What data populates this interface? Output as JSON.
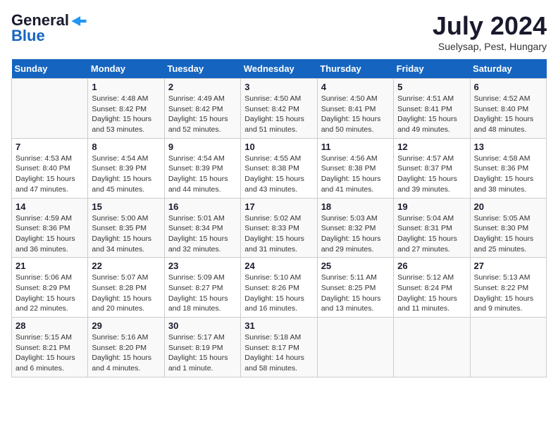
{
  "header": {
    "logo_general": "General",
    "logo_blue": "Blue",
    "month_title": "July 2024",
    "location": "Suelysap, Pest, Hungary"
  },
  "days_of_week": [
    "Sunday",
    "Monday",
    "Tuesday",
    "Wednesday",
    "Thursday",
    "Friday",
    "Saturday"
  ],
  "weeks": [
    [
      {
        "day": "",
        "info": ""
      },
      {
        "day": "1",
        "info": "Sunrise: 4:48 AM\nSunset: 8:42 PM\nDaylight: 15 hours and 53 minutes."
      },
      {
        "day": "2",
        "info": "Sunrise: 4:49 AM\nSunset: 8:42 PM\nDaylight: 15 hours and 52 minutes."
      },
      {
        "day": "3",
        "info": "Sunrise: 4:50 AM\nSunset: 8:42 PM\nDaylight: 15 hours and 51 minutes."
      },
      {
        "day": "4",
        "info": "Sunrise: 4:50 AM\nSunset: 8:41 PM\nDaylight: 15 hours and 50 minutes."
      },
      {
        "day": "5",
        "info": "Sunrise: 4:51 AM\nSunset: 8:41 PM\nDaylight: 15 hours and 49 minutes."
      },
      {
        "day": "6",
        "info": "Sunrise: 4:52 AM\nSunset: 8:40 PM\nDaylight: 15 hours and 48 minutes."
      }
    ],
    [
      {
        "day": "7",
        "info": "Sunrise: 4:53 AM\nSunset: 8:40 PM\nDaylight: 15 hours and 47 minutes."
      },
      {
        "day": "8",
        "info": "Sunrise: 4:54 AM\nSunset: 8:39 PM\nDaylight: 15 hours and 45 minutes."
      },
      {
        "day": "9",
        "info": "Sunrise: 4:54 AM\nSunset: 8:39 PM\nDaylight: 15 hours and 44 minutes."
      },
      {
        "day": "10",
        "info": "Sunrise: 4:55 AM\nSunset: 8:38 PM\nDaylight: 15 hours and 43 minutes."
      },
      {
        "day": "11",
        "info": "Sunrise: 4:56 AM\nSunset: 8:38 PM\nDaylight: 15 hours and 41 minutes."
      },
      {
        "day": "12",
        "info": "Sunrise: 4:57 AM\nSunset: 8:37 PM\nDaylight: 15 hours and 39 minutes."
      },
      {
        "day": "13",
        "info": "Sunrise: 4:58 AM\nSunset: 8:36 PM\nDaylight: 15 hours and 38 minutes."
      }
    ],
    [
      {
        "day": "14",
        "info": "Sunrise: 4:59 AM\nSunset: 8:36 PM\nDaylight: 15 hours and 36 minutes."
      },
      {
        "day": "15",
        "info": "Sunrise: 5:00 AM\nSunset: 8:35 PM\nDaylight: 15 hours and 34 minutes."
      },
      {
        "day": "16",
        "info": "Sunrise: 5:01 AM\nSunset: 8:34 PM\nDaylight: 15 hours and 32 minutes."
      },
      {
        "day": "17",
        "info": "Sunrise: 5:02 AM\nSunset: 8:33 PM\nDaylight: 15 hours and 31 minutes."
      },
      {
        "day": "18",
        "info": "Sunrise: 5:03 AM\nSunset: 8:32 PM\nDaylight: 15 hours and 29 minutes."
      },
      {
        "day": "19",
        "info": "Sunrise: 5:04 AM\nSunset: 8:31 PM\nDaylight: 15 hours and 27 minutes."
      },
      {
        "day": "20",
        "info": "Sunrise: 5:05 AM\nSunset: 8:30 PM\nDaylight: 15 hours and 25 minutes."
      }
    ],
    [
      {
        "day": "21",
        "info": "Sunrise: 5:06 AM\nSunset: 8:29 PM\nDaylight: 15 hours and 22 minutes."
      },
      {
        "day": "22",
        "info": "Sunrise: 5:07 AM\nSunset: 8:28 PM\nDaylight: 15 hours and 20 minutes."
      },
      {
        "day": "23",
        "info": "Sunrise: 5:09 AM\nSunset: 8:27 PM\nDaylight: 15 hours and 18 minutes."
      },
      {
        "day": "24",
        "info": "Sunrise: 5:10 AM\nSunset: 8:26 PM\nDaylight: 15 hours and 16 minutes."
      },
      {
        "day": "25",
        "info": "Sunrise: 5:11 AM\nSunset: 8:25 PM\nDaylight: 15 hours and 13 minutes."
      },
      {
        "day": "26",
        "info": "Sunrise: 5:12 AM\nSunset: 8:24 PM\nDaylight: 15 hours and 11 minutes."
      },
      {
        "day": "27",
        "info": "Sunrise: 5:13 AM\nSunset: 8:22 PM\nDaylight: 15 hours and 9 minutes."
      }
    ],
    [
      {
        "day": "28",
        "info": "Sunrise: 5:15 AM\nSunset: 8:21 PM\nDaylight: 15 hours and 6 minutes."
      },
      {
        "day": "29",
        "info": "Sunrise: 5:16 AM\nSunset: 8:20 PM\nDaylight: 15 hours and 4 minutes."
      },
      {
        "day": "30",
        "info": "Sunrise: 5:17 AM\nSunset: 8:19 PM\nDaylight: 15 hours and 1 minute."
      },
      {
        "day": "31",
        "info": "Sunrise: 5:18 AM\nSunset: 8:17 PM\nDaylight: 14 hours and 58 minutes."
      },
      {
        "day": "",
        "info": ""
      },
      {
        "day": "",
        "info": ""
      },
      {
        "day": "",
        "info": ""
      }
    ]
  ]
}
